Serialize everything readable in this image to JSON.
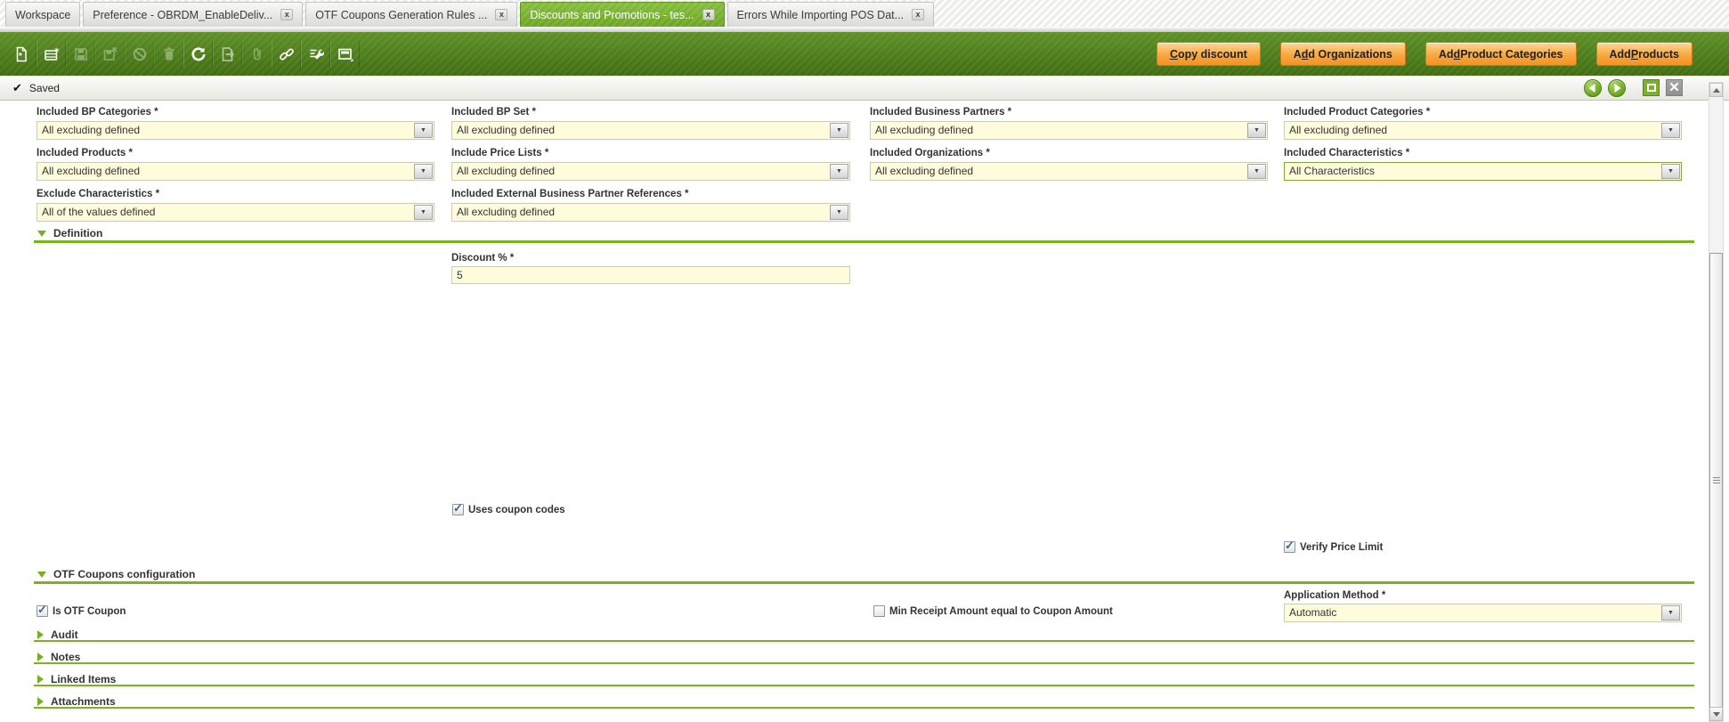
{
  "window": {
    "tabs": [
      {
        "label": "Workspace",
        "closable": false,
        "active": false
      },
      {
        "label": "Preference - OBRDM_EnableDeliv...",
        "closable": true,
        "active": false
      },
      {
        "label": "OTF Coupons Generation Rules ...",
        "closable": true,
        "active": false
      },
      {
        "label": "Discounts and Promotions - tes...",
        "closable": true,
        "active": true
      },
      {
        "label": "Errors While Importing POS Dat...",
        "closable": true,
        "active": false
      }
    ]
  },
  "toolbar": {
    "icon_names": [
      "new-record-icon",
      "new-row-icon",
      "save-icon",
      "save-and-close-icon",
      "undo-icon",
      "delete-icon",
      "refresh-icon",
      "export-icon",
      "attachment-icon",
      "link-icon",
      "tools-icon",
      "form-grid-toggle-icon"
    ],
    "buttons": [
      {
        "pre": "",
        "key": "C",
        "post": "opy discount"
      },
      {
        "pre": "A",
        "key": "d",
        "post": "d Organizations"
      },
      {
        "pre": "Ad",
        "key": "d",
        "post": " Product Categories"
      },
      {
        "pre": "Add ",
        "key": "P",
        "post": "roducts"
      }
    ]
  },
  "statusbar": {
    "saved_label": "Saved"
  },
  "glyphs": {
    "check": "✔",
    "close_tab": "x",
    "close_window": "✕",
    "dropdown": "▼",
    "checkbox": "✓"
  },
  "form": {
    "row1": [
      {
        "label": "Included BP Categories *",
        "value": "All excluding defined"
      },
      {
        "label": "Included BP Set *",
        "value": "All excluding defined"
      },
      {
        "label": "Included Business Partners *",
        "value": "All excluding defined"
      },
      {
        "label": "Included Product Categories *",
        "value": "All excluding defined"
      }
    ],
    "row2": [
      {
        "label": "Included Products *",
        "value": "All excluding defined"
      },
      {
        "label": "Include Price Lists *",
        "value": "All excluding defined"
      },
      {
        "label": "Included Organizations *",
        "value": "All excluding defined"
      },
      {
        "label": "Included Characteristics *",
        "value": "All Characteristics"
      }
    ],
    "row3": [
      {
        "label": "Exclude Characteristics *",
        "value": "All of the values defined"
      },
      {
        "label": "Included External Business Partner References *",
        "value": "All excluding defined"
      }
    ],
    "definition": {
      "title": "Definition",
      "discount_label": "Discount % *",
      "discount_value": "5",
      "uses_coupon_codes_label": "Uses coupon codes",
      "verify_price_limit_label": "Verify Price Limit"
    },
    "otf": {
      "title": "OTF Coupons configuration",
      "is_otf_label": "Is OTF Coupon",
      "min_receipt_label": "Min Receipt Amount equal to Coupon Amount",
      "application_method_label": "Application Method *",
      "application_method_value": "Automatic"
    },
    "collapsed_sections": [
      "Audit",
      "Notes",
      "Linked Items",
      "Attachments"
    ]
  },
  "colors": {
    "accent_green": "#76b82a",
    "toolbar_green": "#4e7d1a",
    "button_orange": "#f8a840",
    "field_yellow": "#fffcdc",
    "active_tab_green": "#74b02d"
  }
}
